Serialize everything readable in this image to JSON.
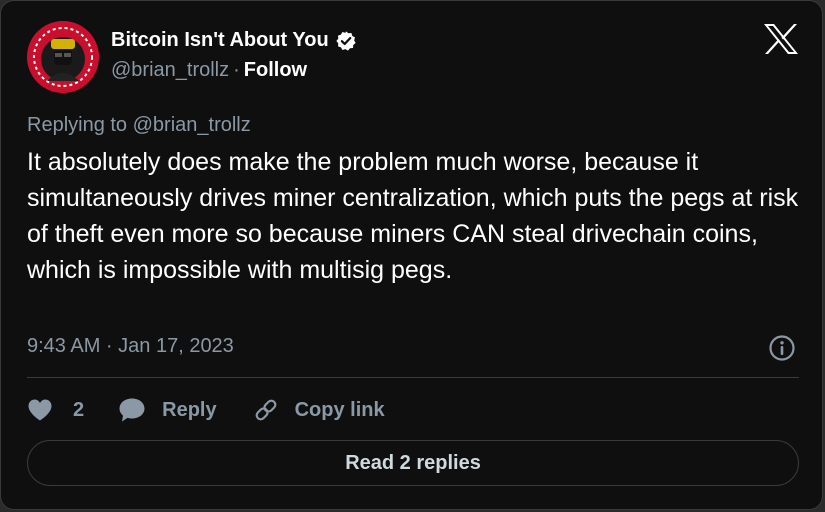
{
  "author": {
    "name": "Bitcoin Isn't About You",
    "handle": "@brian_trollz",
    "separator": "·",
    "follow_label": "Follow",
    "verified": true
  },
  "tweet": {
    "replying_to": "Replying to @brian_trollz",
    "text": "It absolutely does make the problem much worse, because it simultaneously drives miner centralization, which puts the pegs at risk of theft even more so because miners CAN steal drivechain coins, which is impossible with multisig pegs.",
    "timestamp": "9:43 AM · Jan 17, 2023"
  },
  "actions": {
    "like_count": "2",
    "reply_label": "Reply",
    "copy_link_label": "Copy link"
  },
  "read_replies_label": "Read 2 replies",
  "icons": {
    "logo": "x-logo-icon",
    "verified": "verified-badge-icon",
    "info": "info-icon",
    "like": "heart-icon",
    "reply": "speech-bubble-icon",
    "copy": "link-icon"
  },
  "colors": {
    "background": "#0f0f0f",
    "text": "#ffffff",
    "muted": "#8b98a5",
    "border": "#3a3a3a",
    "avatar_accent": "#c8102e"
  }
}
